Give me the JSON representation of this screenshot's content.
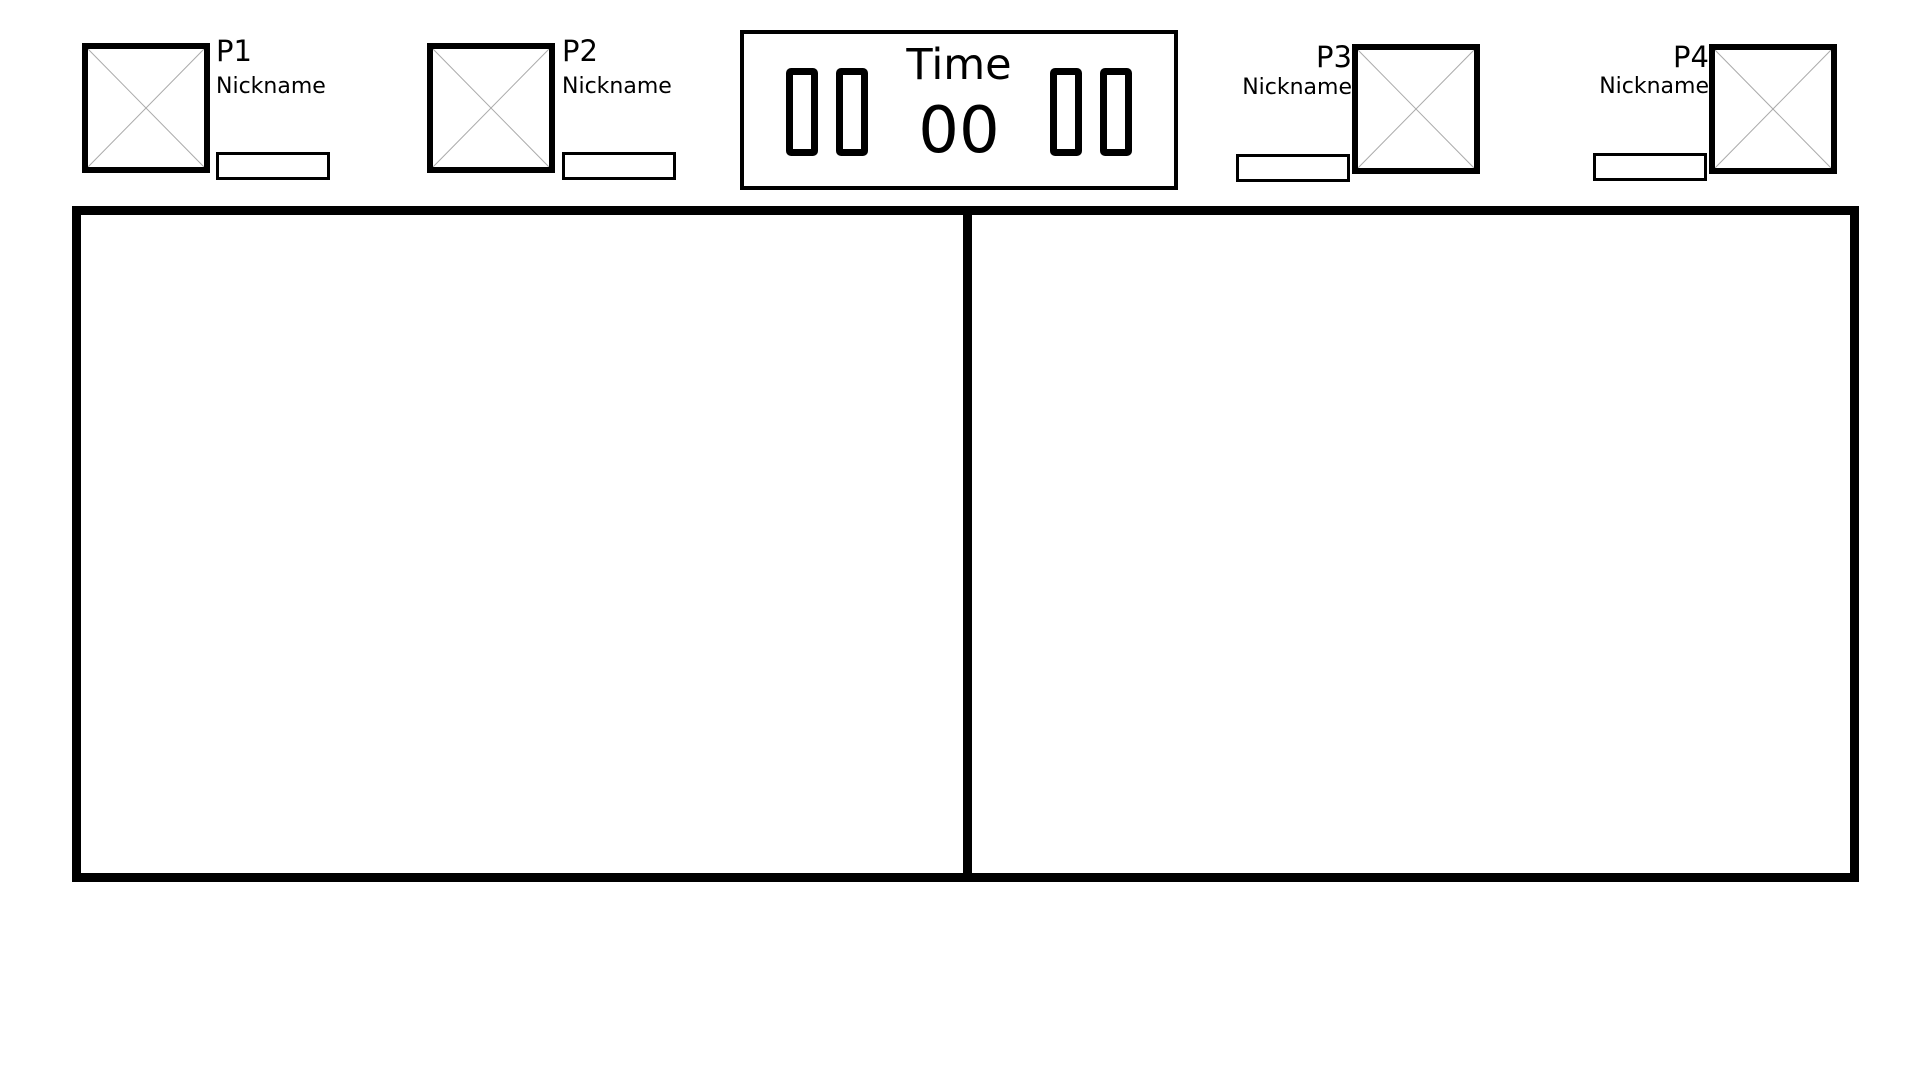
{
  "players": [
    {
      "label": "P1",
      "nickname": "Nickname"
    },
    {
      "label": "P2",
      "nickname": "Nickname"
    },
    {
      "label": "P3",
      "nickname": "Nickname"
    },
    {
      "label": "P4",
      "nickname": "Nickname"
    }
  ],
  "timer": {
    "title": "Time",
    "value": "00"
  },
  "icons": {
    "avatar": "image-placeholder-icon",
    "score_digit": "score-digit-icon"
  },
  "colors": {
    "background": "#ffffff",
    "stroke": "#000000",
    "placeholder_line": "#aaaaaa"
  }
}
